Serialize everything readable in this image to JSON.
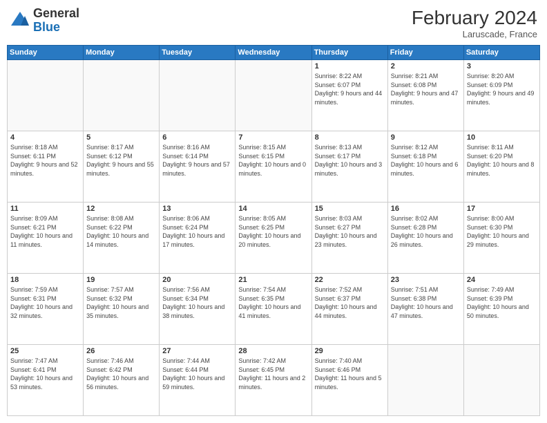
{
  "header": {
    "logo_general": "General",
    "logo_blue": "Blue",
    "month_year": "February 2024",
    "location": "Laruscade, France"
  },
  "weekdays": [
    "Sunday",
    "Monday",
    "Tuesday",
    "Wednesday",
    "Thursday",
    "Friday",
    "Saturday"
  ],
  "weeks": [
    [
      {
        "day": "",
        "info": ""
      },
      {
        "day": "",
        "info": ""
      },
      {
        "day": "",
        "info": ""
      },
      {
        "day": "",
        "info": ""
      },
      {
        "day": "1",
        "info": "Sunrise: 8:22 AM\nSunset: 6:07 PM\nDaylight: 9 hours and 44 minutes."
      },
      {
        "day": "2",
        "info": "Sunrise: 8:21 AM\nSunset: 6:08 PM\nDaylight: 9 hours and 47 minutes."
      },
      {
        "day": "3",
        "info": "Sunrise: 8:20 AM\nSunset: 6:09 PM\nDaylight: 9 hours and 49 minutes."
      }
    ],
    [
      {
        "day": "4",
        "info": "Sunrise: 8:18 AM\nSunset: 6:11 PM\nDaylight: 9 hours and 52 minutes."
      },
      {
        "day": "5",
        "info": "Sunrise: 8:17 AM\nSunset: 6:12 PM\nDaylight: 9 hours and 55 minutes."
      },
      {
        "day": "6",
        "info": "Sunrise: 8:16 AM\nSunset: 6:14 PM\nDaylight: 9 hours and 57 minutes."
      },
      {
        "day": "7",
        "info": "Sunrise: 8:15 AM\nSunset: 6:15 PM\nDaylight: 10 hours and 0 minutes."
      },
      {
        "day": "8",
        "info": "Sunrise: 8:13 AM\nSunset: 6:17 PM\nDaylight: 10 hours and 3 minutes."
      },
      {
        "day": "9",
        "info": "Sunrise: 8:12 AM\nSunset: 6:18 PM\nDaylight: 10 hours and 6 minutes."
      },
      {
        "day": "10",
        "info": "Sunrise: 8:11 AM\nSunset: 6:20 PM\nDaylight: 10 hours and 8 minutes."
      }
    ],
    [
      {
        "day": "11",
        "info": "Sunrise: 8:09 AM\nSunset: 6:21 PM\nDaylight: 10 hours and 11 minutes."
      },
      {
        "day": "12",
        "info": "Sunrise: 8:08 AM\nSunset: 6:22 PM\nDaylight: 10 hours and 14 minutes."
      },
      {
        "day": "13",
        "info": "Sunrise: 8:06 AM\nSunset: 6:24 PM\nDaylight: 10 hours and 17 minutes."
      },
      {
        "day": "14",
        "info": "Sunrise: 8:05 AM\nSunset: 6:25 PM\nDaylight: 10 hours and 20 minutes."
      },
      {
        "day": "15",
        "info": "Sunrise: 8:03 AM\nSunset: 6:27 PM\nDaylight: 10 hours and 23 minutes."
      },
      {
        "day": "16",
        "info": "Sunrise: 8:02 AM\nSunset: 6:28 PM\nDaylight: 10 hours and 26 minutes."
      },
      {
        "day": "17",
        "info": "Sunrise: 8:00 AM\nSunset: 6:30 PM\nDaylight: 10 hours and 29 minutes."
      }
    ],
    [
      {
        "day": "18",
        "info": "Sunrise: 7:59 AM\nSunset: 6:31 PM\nDaylight: 10 hours and 32 minutes."
      },
      {
        "day": "19",
        "info": "Sunrise: 7:57 AM\nSunset: 6:32 PM\nDaylight: 10 hours and 35 minutes."
      },
      {
        "day": "20",
        "info": "Sunrise: 7:56 AM\nSunset: 6:34 PM\nDaylight: 10 hours and 38 minutes."
      },
      {
        "day": "21",
        "info": "Sunrise: 7:54 AM\nSunset: 6:35 PM\nDaylight: 10 hours and 41 minutes."
      },
      {
        "day": "22",
        "info": "Sunrise: 7:52 AM\nSunset: 6:37 PM\nDaylight: 10 hours and 44 minutes."
      },
      {
        "day": "23",
        "info": "Sunrise: 7:51 AM\nSunset: 6:38 PM\nDaylight: 10 hours and 47 minutes."
      },
      {
        "day": "24",
        "info": "Sunrise: 7:49 AM\nSunset: 6:39 PM\nDaylight: 10 hours and 50 minutes."
      }
    ],
    [
      {
        "day": "25",
        "info": "Sunrise: 7:47 AM\nSunset: 6:41 PM\nDaylight: 10 hours and 53 minutes."
      },
      {
        "day": "26",
        "info": "Sunrise: 7:46 AM\nSunset: 6:42 PM\nDaylight: 10 hours and 56 minutes."
      },
      {
        "day": "27",
        "info": "Sunrise: 7:44 AM\nSunset: 6:44 PM\nDaylight: 10 hours and 59 minutes."
      },
      {
        "day": "28",
        "info": "Sunrise: 7:42 AM\nSunset: 6:45 PM\nDaylight: 11 hours and 2 minutes."
      },
      {
        "day": "29",
        "info": "Sunrise: 7:40 AM\nSunset: 6:46 PM\nDaylight: 11 hours and 5 minutes."
      },
      {
        "day": "",
        "info": ""
      },
      {
        "day": "",
        "info": ""
      }
    ]
  ]
}
